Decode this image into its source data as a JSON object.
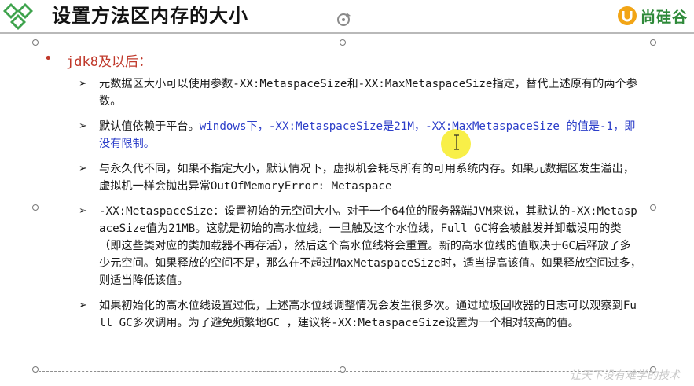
{
  "header": {
    "title": "设置方法区内存的大小",
    "brand": "尚硅谷",
    "brand_color": "#2f8a3a"
  },
  "content": {
    "bullet_heading": "jdk8及以后：",
    "items": [
      {
        "text": "元数据区大小可以使用参数-XX:MetaspaceSize和-XX:MaxMetaspaceSize指定，替代上述原有的两个参数。"
      },
      {
        "text_black": "默认值依赖于平台。",
        "text_blue": "windows下，-XX:MetaspaceSize是21M，-XX:MaxMetaspaceSize 的值是-1，即没有限制。"
      },
      {
        "text": "与永久代不同，如果不指定大小，默认情况下，虚拟机会耗尽所有的可用系统内存。如果元数据区发生溢出，虚拟机一样会抛出异常OutOfMemoryError: Metaspace"
      },
      {
        "text": "-XX:MetaspaceSize：设置初始的元空间大小。对于一个64位的服务器端JVM来说，其默认的-XX:MetaspaceSize值为21MB。这就是初始的高水位线，一旦触及这个水位线，Full GC将会被触发并卸载没用的类（即这些类对应的类加载器不再存活），然后这个高水位线将会重置。新的高水位线的值取决于GC后释放了多少元空间。如果释放的空间不足，那么在不超过MaxMetaspaceSize时，适当提高该值。如果释放空间过多，则适当降低该值。"
      },
      {
        "text": "如果初始化的高水位线设置过低，上述高水位线调整情况会发生很多次。通过垃圾回收器的日志可以观察到Full GC多次调用。为了避免频繁地GC ，建议将-XX:MetaspaceSize设置为一个相对较高的值。"
      }
    ],
    "arrow_glyph": "➢",
    "bullet_glyph": "•"
  },
  "watermark": "让天下没有难学的技术",
  "colors": {
    "bullet_red": "#c0392b",
    "link_blue": "#2c3ec9",
    "highlight_yellow": "#f7ec28"
  }
}
